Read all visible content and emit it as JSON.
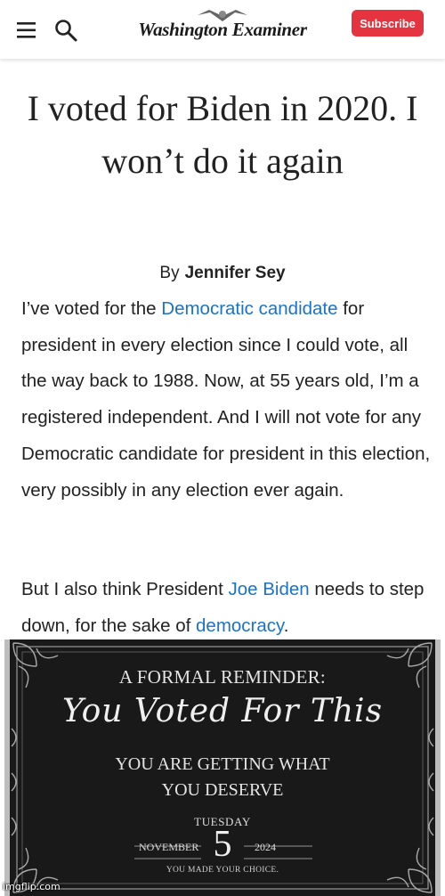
{
  "header": {
    "logo_text": "Washington Examiner",
    "subscribe_label": "Subscribe",
    "menu_icon": "hamburger-menu-icon",
    "search_icon": "search-icon",
    "accent": "#e5343f"
  },
  "article": {
    "headline": "I voted for Biden in 2020. I won’t do it again",
    "byline_prefix": "By",
    "author": "Jennifer Sey",
    "p1": {
      "t1": "I’ve voted for the ",
      "link1": "Democratic candidate",
      "t2": " for president in every election since I could vote, all the way back to 1988. Now, at 55 years old, I’m a registered independent. And I will not vote for any Democratic candidate for president in this election, very possibly in any election ever again."
    },
    "p2": {
      "t1": "But I also think President ",
      "link1": "Joe Biden",
      "t2": " needs to step down, for the sake of ",
      "link2": "democracy",
      "t3": "."
    },
    "link_color": "#1a73c8"
  },
  "meme": {
    "line1": "A FORMAL REMINDER:",
    "script": "You Voted For This",
    "line3a": "YOU ARE GETTING WHAT",
    "line3b": "YOU DESERVE",
    "day": "TUESDAY",
    "month": "NOVEMBER",
    "date": "5",
    "year": "2024",
    "choice": "YOU MADE YOUR CHOICE."
  },
  "watermark": "imgflip.com"
}
